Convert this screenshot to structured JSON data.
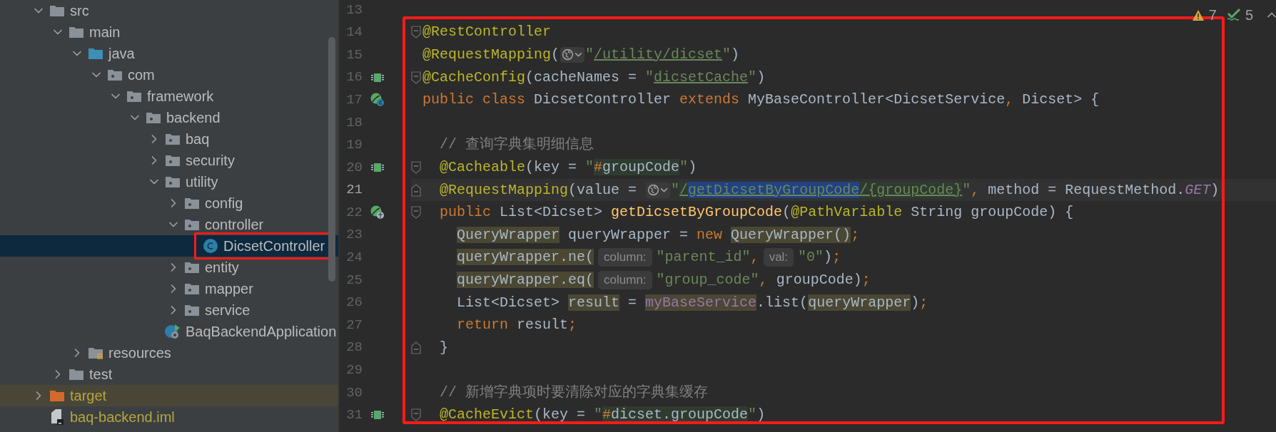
{
  "project_tree": [
    {
      "label": "src",
      "kind": "folder",
      "expanded": true,
      "selected": false,
      "children": [
        {
          "label": "main",
          "kind": "folder",
          "expanded": true,
          "selected": false,
          "children": [
            {
              "label": "java",
              "kind": "source-root",
              "expanded": true,
              "selected": false,
              "children": [
                {
                  "label": "com",
                  "kind": "package",
                  "expanded": true,
                  "selected": false,
                  "children": [
                    {
                      "label": "framework",
                      "kind": "package",
                      "expanded": true,
                      "selected": false,
                      "children": [
                        {
                          "label": "backend",
                          "kind": "package",
                          "expanded": true,
                          "selected": false,
                          "children": [
                            {
                              "label": "baq",
                              "kind": "package",
                              "expanded": false,
                              "selected": false
                            },
                            {
                              "label": "security",
                              "kind": "package",
                              "expanded": false,
                              "selected": false
                            },
                            {
                              "label": "utility",
                              "kind": "package",
                              "expanded": true,
                              "selected": false,
                              "children": [
                                {
                                  "label": "config",
                                  "kind": "package",
                                  "expanded": false,
                                  "selected": false
                                },
                                {
                                  "label": "controller",
                                  "kind": "package",
                                  "expanded": true,
                                  "selected": false,
                                  "children": [
                                    {
                                      "label": "DicsetController",
                                      "kind": "class",
                                      "selected": true,
                                      "boxed": true
                                    }
                                  ]
                                },
                                {
                                  "label": "entity",
                                  "kind": "package",
                                  "expanded": false,
                                  "selected": false
                                },
                                {
                                  "label": "mapper",
                                  "kind": "package",
                                  "expanded": false,
                                  "selected": false
                                },
                                {
                                  "label": "service",
                                  "kind": "package",
                                  "expanded": false,
                                  "selected": false
                                }
                              ]
                            },
                            {
                              "label": "BaqBackendApplication",
                              "kind": "app-class",
                              "selected": false
                            }
                          ]
                        }
                      ]
                    }
                  ]
                }
              ]
            },
            {
              "label": "resources",
              "kind": "resources",
              "expanded": false,
              "selected": false
            }
          ]
        },
        {
          "label": "test",
          "kind": "folder",
          "expanded": false,
          "selected": false
        }
      ]
    },
    {
      "label": "target",
      "kind": "excluded",
      "expanded": false,
      "selected": false
    },
    {
      "label": "baq-backend.iml",
      "kind": "module-file",
      "selected": false
    }
  ],
  "editor": {
    "boxed": true,
    "inspections": {
      "warnings": "7",
      "weak_warnings": "5"
    },
    "lines": [
      {
        "number": "13",
        "selected": false
      },
      {
        "number": "14",
        "selected": false,
        "fold": {
          "kind": "start"
        },
        "tokens": [
          {
            "text": "@RestController",
            "kind": "annotation"
          }
        ]
      },
      {
        "number": "15",
        "selected": false,
        "tokens": [
          {
            "text": "@RequestMapping",
            "kind": "annotation"
          },
          {
            "text": "(",
            "kind": "plain"
          },
          {
            "kind": "url-inlay"
          },
          {
            "text": "\"",
            "kind": "string"
          },
          {
            "text": "/utility/dicset",
            "kind": "link"
          },
          {
            "text": "\"",
            "kind": "string"
          },
          {
            "text": ")",
            "kind": "plain"
          }
        ]
      },
      {
        "number": "16",
        "selected": false,
        "fold": {
          "kind": "start"
        },
        "gutter_icon": {
          "kind": "bean"
        },
        "tokens": [
          {
            "text": "@CacheConfig",
            "kind": "annotation"
          },
          {
            "text": "(cacheNames = ",
            "kind": "plain"
          },
          {
            "text": "\"",
            "kind": "string"
          },
          {
            "text": "dicsetCache",
            "kind": "link"
          },
          {
            "text": "\"",
            "kind": "string"
          },
          {
            "text": ")",
            "kind": "plain"
          }
        ]
      },
      {
        "number": "17",
        "selected": false,
        "gutter_icon": {
          "kind": "class-bean"
        },
        "tokens": [
          {
            "text": "public class ",
            "kind": "keyword"
          },
          {
            "text": "DicsetController",
            "kind": "plain"
          },
          {
            "text": " extends ",
            "kind": "keyword"
          },
          {
            "text": "MyBaseController<DicsetService",
            "kind": "plain"
          },
          {
            "text": ",",
            "kind": "keyword"
          },
          {
            "text": " Dicset> {",
            "kind": "plain"
          }
        ]
      },
      {
        "number": "18",
        "selected": false
      },
      {
        "number": "19",
        "selected": false,
        "tokens": [
          {
            "text": "  // 查询字典集明细信息",
            "kind": "comment"
          }
        ]
      },
      {
        "number": "20",
        "selected": false,
        "fold": {
          "kind": "start"
        },
        "gutter_icon": {
          "kind": "bean"
        },
        "tokens": [
          {
            "text": "  @Cacheable",
            "kind": "annotation"
          },
          {
            "text": "(key = ",
            "kind": "plain"
          },
          {
            "text": "\"",
            "kind": "string"
          },
          {
            "text": "#",
            "kind": "keyword",
            "highlight": {
              "kind": "injection"
            }
          },
          {
            "text": "groupCode",
            "kind": "plain",
            "highlight": {
              "kind": "injection"
            }
          },
          {
            "text": "\"",
            "kind": "string"
          },
          {
            "text": ")",
            "kind": "plain"
          }
        ]
      },
      {
        "number": "21",
        "selected": true,
        "fold": {
          "kind": "end"
        },
        "tokens": [
          {
            "text": "  @RequestMapping",
            "kind": "annotation"
          },
          {
            "text": "(value = ",
            "kind": "plain"
          },
          {
            "kind": "url-inlay"
          },
          {
            "text": "\"",
            "kind": "string"
          },
          {
            "text": "/",
            "kind": "link",
            "highlight": {
              "kind": "injection"
            }
          },
          {
            "text": "getDicsetByGroupCode",
            "kind": "link",
            "highlight": {
              "kind": "selection"
            }
          },
          {
            "text": "/{groupCode}",
            "kind": "link",
            "highlight": {
              "kind": "injection"
            }
          },
          {
            "text": "\"",
            "kind": "string"
          },
          {
            "text": ",",
            "kind": "keyword"
          },
          {
            "text": " method = RequestMethod.",
            "kind": "plain"
          },
          {
            "text": "GET",
            "kind": "constant"
          },
          {
            "text": ")",
            "kind": "plain"
          }
        ]
      },
      {
        "number": "22",
        "selected": false,
        "fold": {
          "kind": "start"
        },
        "gutter_icon": {
          "kind": "web-endpoint"
        },
        "tokens": [
          {
            "text": "  public ",
            "kind": "keyword"
          },
          {
            "text": "List<Dicset> ",
            "kind": "plain"
          },
          {
            "text": "getDicsetByGroupCode",
            "kind": "method"
          },
          {
            "text": "(",
            "kind": "plain"
          },
          {
            "text": "@PathVariable",
            "kind": "annotation"
          },
          {
            "text": " String groupCode) {",
            "kind": "plain"
          }
        ]
      },
      {
        "number": "23",
        "selected": false,
        "tokens": [
          {
            "text": "    QueryWrapper",
            "kind": "plain",
            "highlight": {
              "kind": "usage"
            }
          },
          {
            "text": " queryWrapper = ",
            "kind": "plain"
          },
          {
            "text": "new ",
            "kind": "keyword"
          },
          {
            "text": "QueryWrapper()",
            "kind": "plain",
            "highlight": {
              "kind": "usage"
            }
          },
          {
            "text": ";",
            "kind": "keyword"
          }
        ]
      },
      {
        "number": "24",
        "selected": false,
        "tokens": [
          {
            "text": "    queryWrapper.ne(",
            "kind": "plain",
            "highlight": {
              "kind": "usage"
            }
          },
          {
            "text": "column:",
            "kind": "hint"
          },
          {
            "text": "\"parent_id\"",
            "kind": "string"
          },
          {
            "text": ",",
            "kind": "keyword"
          },
          {
            "text": "val:",
            "kind": "hint"
          },
          {
            "text": "\"0\"",
            "kind": "string"
          },
          {
            "text": ")",
            "kind": "plain"
          },
          {
            "text": ";",
            "kind": "keyword"
          }
        ]
      },
      {
        "number": "25",
        "selected": false,
        "tokens": [
          {
            "text": "    queryWrapper.eq(",
            "kind": "plain",
            "highlight": {
              "kind": "usage"
            }
          },
          {
            "text": "column:",
            "kind": "hint"
          },
          {
            "text": "\"group_code\"",
            "kind": "string"
          },
          {
            "text": ",",
            "kind": "keyword"
          },
          {
            "text": " groupCode)",
            "kind": "plain"
          },
          {
            "text": ";",
            "kind": "keyword"
          }
        ]
      },
      {
        "number": "26",
        "selected": false,
        "tokens": [
          {
            "text": "    List<Dicset> ",
            "kind": "plain"
          },
          {
            "text": "result",
            "kind": "plain",
            "highlight": {
              "kind": "usage"
            }
          },
          {
            "text": " = ",
            "kind": "plain"
          },
          {
            "text": "myBaseService",
            "kind": "field",
            "highlight": {
              "kind": "usage"
            }
          },
          {
            "text": ".list(",
            "kind": "plain"
          },
          {
            "text": "queryWrapper",
            "kind": "plain",
            "highlight": {
              "kind": "usage"
            }
          },
          {
            "text": ")",
            "kind": "plain"
          },
          {
            "text": ";",
            "kind": "keyword"
          }
        ]
      },
      {
        "number": "27",
        "selected": false,
        "tokens": [
          {
            "text": "    return ",
            "kind": "keyword"
          },
          {
            "text": "result",
            "kind": "plain"
          },
          {
            "text": ";",
            "kind": "keyword"
          }
        ]
      },
      {
        "number": "28",
        "selected": false,
        "fold": {
          "kind": "end"
        },
        "tokens": [
          {
            "text": "  }",
            "kind": "plain"
          }
        ]
      },
      {
        "number": "29",
        "selected": false
      },
      {
        "number": "30",
        "selected": false,
        "tokens": [
          {
            "text": "  // 新增字典项时要清除对应的字典集缓存",
            "kind": "comment"
          }
        ]
      },
      {
        "number": "31",
        "selected": false,
        "fold": {
          "kind": "start"
        },
        "gutter_icon": {
          "kind": "bean"
        },
        "tokens": [
          {
            "text": "  @CacheEvict",
            "kind": "annotation"
          },
          {
            "text": "(key = ",
            "kind": "plain"
          },
          {
            "text": "\"",
            "kind": "string"
          },
          {
            "text": "#",
            "kind": "keyword",
            "highlight": {
              "kind": "injection"
            }
          },
          {
            "text": "dicset.groupCode",
            "kind": "plain",
            "highlight": {
              "kind": "injection"
            }
          },
          {
            "text": "\"",
            "kind": "string"
          },
          {
            "text": ")",
            "kind": "plain"
          }
        ]
      }
    ]
  }
}
